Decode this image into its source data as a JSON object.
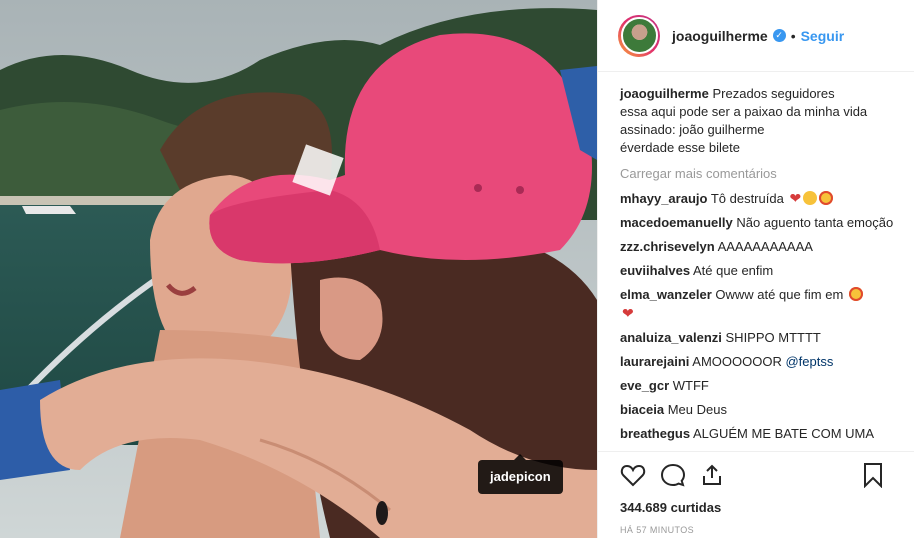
{
  "photo": {
    "tag_label": "jadepicon"
  },
  "header": {
    "username": "joaoguilherme",
    "separator": "•",
    "follow_label": "Seguir"
  },
  "caption": {
    "username": "joaoguilherme",
    "lines": [
      "Prezados seguidores",
      "essa aqui pode ser a paixao da minha vida",
      "assinado: joão guilherme",
      "éverdade esse bilete"
    ]
  },
  "load_more_label": "Carregar mais comentários",
  "comments": [
    {
      "user": "mhayy_araujo",
      "text": "Tô destruída",
      "emojis": [
        "heart",
        "face",
        "eyes"
      ]
    },
    {
      "user": "macedoemanuelly",
      "text": "Não aguento tanta emoção",
      "emojis": []
    },
    {
      "user": "zzz.chrisevelyn",
      "text": "AAAAAAAAAAA",
      "emojis": []
    },
    {
      "user": "euviihalves",
      "text": "Até que enfim",
      "emojis": []
    },
    {
      "user": "elma_wanzeler",
      "text": "Owww até que fim em",
      "emojis": [
        "eyes",
        "heart"
      ]
    },
    {
      "user": "analuiza_valenzi",
      "text": "SHIPPO MTTTT",
      "emojis": []
    },
    {
      "user": "laurarejaini",
      "text": "AMOOOOOOR",
      "mention": "@feptss",
      "emojis": []
    },
    {
      "user": "eve_gcr",
      "text": "WTFF",
      "emojis": []
    },
    {
      "user": "biaceia",
      "text": "Meu Deus",
      "emojis": []
    },
    {
      "user": "breathegus",
      "text": "ALGUÉM ME BATE COM UMA",
      "emojis": []
    }
  ],
  "likes_label": "344.689 curtidas",
  "time_label": "HÁ 57 MINUTOS",
  "icons": {
    "verified": "verified-badge-icon",
    "like": "heart-icon",
    "comment": "comment-bubble-icon",
    "share": "share-icon",
    "save": "bookmark-icon"
  },
  "colors": {
    "link_blue": "#3897f0",
    "muted": "#999999",
    "cap_pink": "#e8497a"
  }
}
